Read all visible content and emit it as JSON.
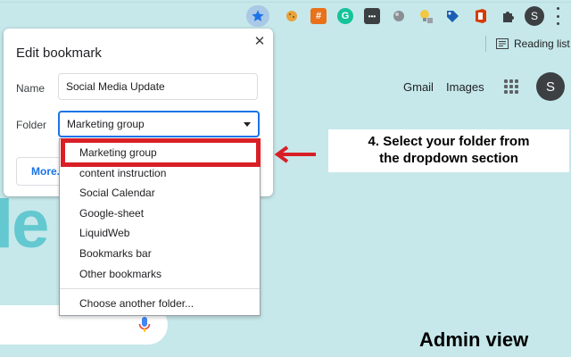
{
  "reading_list": {
    "label": "Reading list"
  },
  "toolbar": {
    "profile_initial": "S",
    "extensions": [
      {
        "icon": "cookie-extension-icon",
        "color": "#e8a33d",
        "glyph": "◉"
      },
      {
        "icon": "hash-extension-icon",
        "color": "#e8711a",
        "glyph": "#"
      },
      {
        "icon": "grammarly-icon",
        "color": "#15c39a",
        "glyph": "G"
      },
      {
        "icon": "keyboard-extension-icon",
        "color": "#3c4043",
        "glyph": "▪▪"
      },
      {
        "icon": "globe-extension-icon",
        "color": "#8a8f94",
        "glyph": "●"
      },
      {
        "icon": "lightbulb-extension-icon",
        "color": "#f2c744",
        "glyph": "✦"
      },
      {
        "icon": "tag-extension-icon",
        "color": "#1a5fb4",
        "glyph": "◆"
      },
      {
        "icon": "office-icon",
        "color": "#d83b01",
        "glyph": "O"
      }
    ]
  },
  "google_page": {
    "gmail": "Gmail",
    "images": "Images",
    "avatar_initial": "S",
    "logo_fragment": "le"
  },
  "dialog": {
    "title": "Edit bookmark",
    "name_label": "Name",
    "name_value": "Social Media Update",
    "folder_label": "Folder",
    "folder_value": "Marketing group",
    "more_label": "More..."
  },
  "dropdown": {
    "options": [
      "Marketing group",
      "content instruction",
      "Social Calendar",
      "Google-sheet",
      "LiquidWeb",
      "Bookmarks bar",
      "Other bookmarks"
    ],
    "choose_another": "Choose another folder..."
  },
  "annotation": {
    "callout_line1": "4. Select your folder from",
    "callout_line2": "the dropdown section",
    "highlight_color": "#d91f26",
    "footer": "Admin view"
  }
}
